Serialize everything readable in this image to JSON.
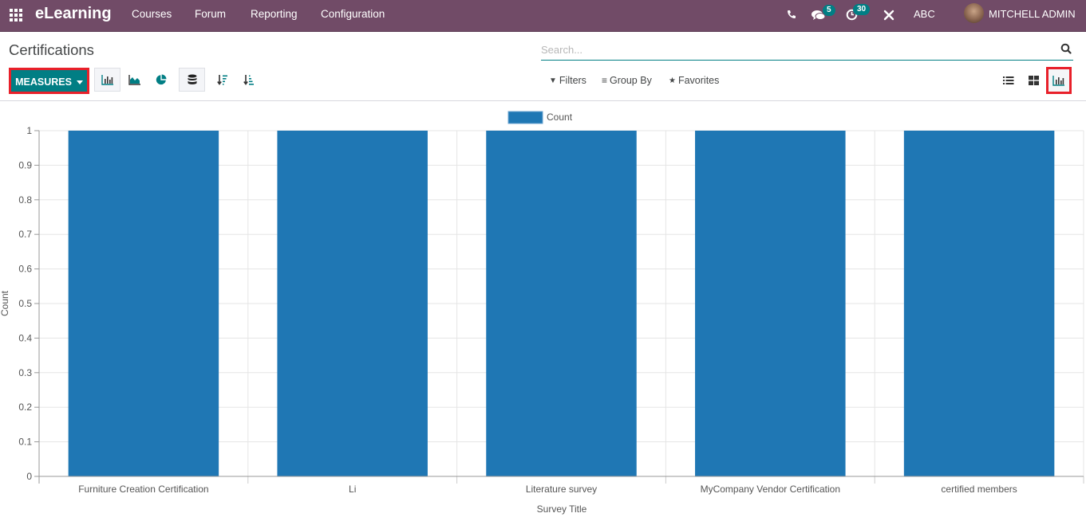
{
  "navbar": {
    "app_name": "eLearning",
    "menu": [
      "Courses",
      "Forum",
      "Reporting",
      "Configuration"
    ],
    "icons": {
      "apps": "apps-grid-icon",
      "phone": "phone-icon",
      "messages": "chat-icon",
      "activities": "clock-icon",
      "debug": "tools-icon"
    },
    "messages_count": "5",
    "activities_count": "30",
    "company": "ABC",
    "user_name": "MITCHELL ADMIN"
  },
  "control_panel": {
    "title": "Certifications",
    "search_placeholder": "Search...",
    "measures_label": "MEASURES",
    "filters_label": "Filters",
    "group_by_label": "Group By",
    "favorites_label": "Favorites",
    "chart_type_buttons": [
      "bar-chart",
      "line-chart",
      "pie-chart"
    ],
    "stacked_button": "stacked",
    "sort_buttons": [
      "descending",
      "ascending"
    ],
    "views": [
      "list",
      "kanban",
      "graph"
    ],
    "active_view": "graph",
    "active_chart_type": "bar-chart"
  },
  "colors": {
    "navbar": "#714B67",
    "accent": "#017e84",
    "bar": "#1f77b4",
    "highlight": "#e8202a"
  },
  "chart_data": {
    "type": "bar",
    "title": "",
    "categories": [
      "Furniture Creation Certification",
      "Li",
      "Literature survey",
      "MyCompany Vendor Certification",
      "certified members"
    ],
    "series": [
      {
        "name": "Count",
        "values": [
          1,
          1,
          1,
          1,
          1
        ]
      }
    ],
    "xlabel": "Survey Title",
    "ylabel": "Count",
    "ylim": [
      0,
      1
    ],
    "yticks": [
      0,
      0.1,
      0.2,
      0.3,
      0.4,
      0.5,
      0.6,
      0.7,
      0.8,
      0.9,
      1
    ],
    "ytick_labels": [
      "0",
      "0.1",
      "0.2",
      "0.3",
      "0.4",
      "0.5",
      "0.6",
      "0.7",
      "0.8",
      "0.9",
      "1"
    ],
    "grid": true,
    "legend": "top-center"
  }
}
